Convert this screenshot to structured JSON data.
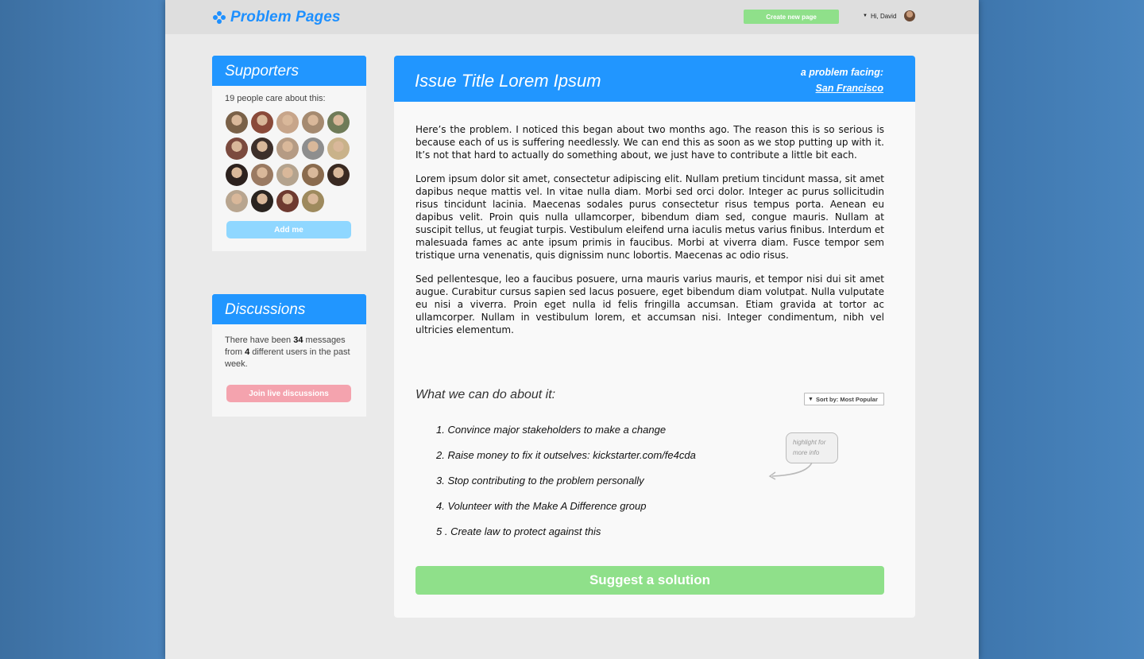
{
  "header": {
    "logo_text": "Problem Pages",
    "create_label": "Create new page",
    "greeting": "Hi,  David"
  },
  "supporters": {
    "title": "Supporters",
    "count_text": "19 people care about this:",
    "avatar_colors": [
      "#7a6148",
      "#8a4a3a",
      "#c7a58a",
      "#a58a70",
      "#6f7b58",
      "#7b4a3e",
      "#3d2f2a",
      "#b59b84",
      "#8e8e8e",
      "#c9b28a",
      "#2c211e",
      "#9a7a62",
      "#b4a38e",
      "#8a6b4e",
      "#3a2a22",
      "#b8a58f",
      "#2a2420",
      "#6e3a30",
      "#9e8a5e"
    ],
    "add_label": "Add me"
  },
  "discussions": {
    "title": "Discussions",
    "text_1": "There have been ",
    "messages": "34",
    "text_2": " messages from ",
    "users": "4",
    "text_3": " different users in the past week.",
    "join_label": "Join live discussions"
  },
  "issue": {
    "title": "Issue Title Lorem Ipsum",
    "facing_label": "a problem facing:",
    "location": "San Francisco",
    "paragraphs": [
      "Here’s the problem. I noticed this began about two months ago. The reason this is so serious is because each of us is suffering needlessly. We can end this as soon as we stop putting up with it. It’s not that hard to actually do something about, we just have to contribute a little bit each.",
      "Lorem ipsum dolor sit amet, consectetur adipiscing elit. Nullam pretium tincidunt massa, sit amet dapibus neque mattis vel. In vitae nulla diam. Morbi sed orci dolor. Integer ac purus sollicitudin risus tincidunt lacinia. Maecenas sodales purus consectetur risus tempus porta. Aenean eu dapibus velit. Proin quis nulla ullamcorper, bibendum diam sed, congue mauris. Nullam at suscipit tellus, ut feugiat turpis. Vestibulum eleifend urna iaculis metus varius finibus. Interdum et malesuada fames ac ante ipsum primis in faucibus. Morbi at viverra diam. Fusce tempor sem tristique urna venenatis, quis dignissim nunc lobortis. Maecenas ac odio risus.",
      "Sed pellentesque, leo a faucibus posuere, urna mauris varius mauris, et tempor nisi dui sit amet augue. Curabitur cursus sapien sed lacus posuere, eget bibendum diam volutpat. Nulla vulputate eu nisi a viverra. Proin eget nulla id felis fringilla accumsan. Etiam gravida at tortor ac ullamcorper. Nullam in vestibulum lorem, et accumsan nisi. Integer condimentum, nibh vel ultricies elementum."
    ]
  },
  "actions": {
    "title": "What we can do about it:",
    "sort_label": "Sort by: Most Popular",
    "items": [
      "1. Convince major stakeholders to make a change",
      "2. Raise money to fix it outselves: kickstarter.com/fe4cda",
      "3. Stop contributing to the problem personally",
      "4. Volunteer with the Make A Difference group",
      "5 . Create law to protect against this"
    ],
    "hint": "highlight for more info",
    "suggest_label": "Suggest a solution"
  }
}
